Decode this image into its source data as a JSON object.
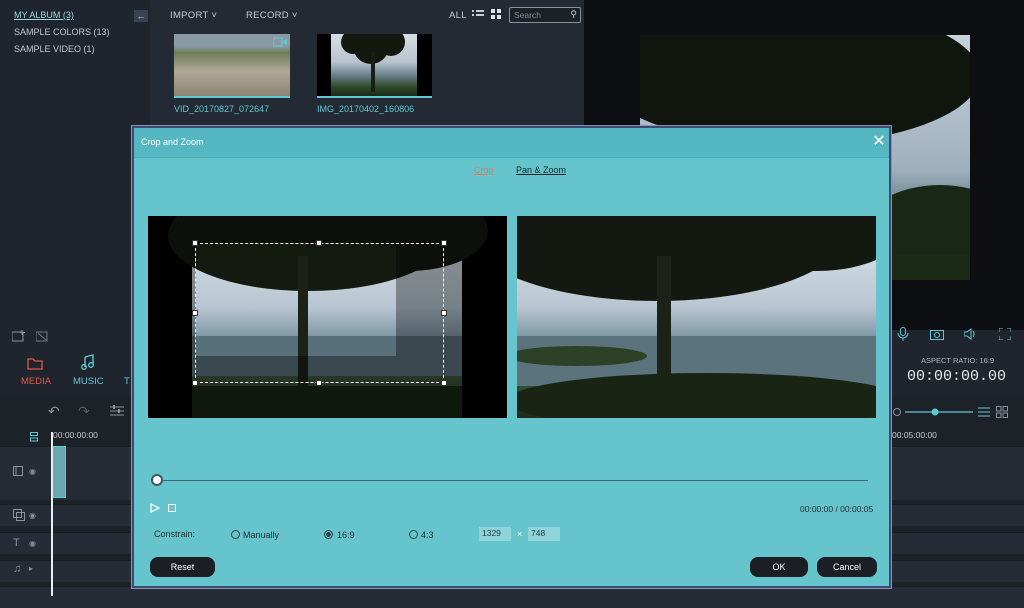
{
  "library": {
    "items": [
      "MY ALBUM (3)",
      "SAMPLE COLORS (13)",
      "SAMPLE VIDEO (1)"
    ]
  },
  "media_toolbar": {
    "import_label": "IMPORT",
    "record_label": "RECORD",
    "all_label": "ALL",
    "search_placeholder": "Search"
  },
  "media_items": [
    {
      "name": "VID_20170827_072647"
    },
    {
      "name": "IMG_20170402_160806"
    }
  ],
  "tabs": {
    "media_label": "MEDIA",
    "music_label": "MUSIC",
    "text_label_partial": "T"
  },
  "preview_info": {
    "aspect_ratio_label": "ASPECT RATIO: 16:9",
    "timecode": "00:00:00.00"
  },
  "timeline": {
    "start_time": "00:00:00:00",
    "end_time": "00:05:00:00"
  },
  "dialog": {
    "title": "Crop and Zoom",
    "tab_crop": "Crop",
    "tab_panzoom": "Pan & Zoom",
    "time_readout": "00:00:00 / 00:00:05",
    "constrain_label": "Constrain:",
    "options": [
      "Manually",
      "16:9",
      "4:3"
    ],
    "selected_option": "16:9",
    "width_value": "1329",
    "x_sep": "×",
    "height_value": "748",
    "reset_label": "Reset",
    "ok_label": "OK",
    "cancel_label": "Cancel"
  },
  "colors": {
    "dialog_bg": "#66c5cc",
    "dialog_title_bg": "#54b7c1",
    "crop_tab_color": "#e07a5a",
    "accent_red": "#e0574a",
    "accent_teal": "#5ec8d4"
  }
}
